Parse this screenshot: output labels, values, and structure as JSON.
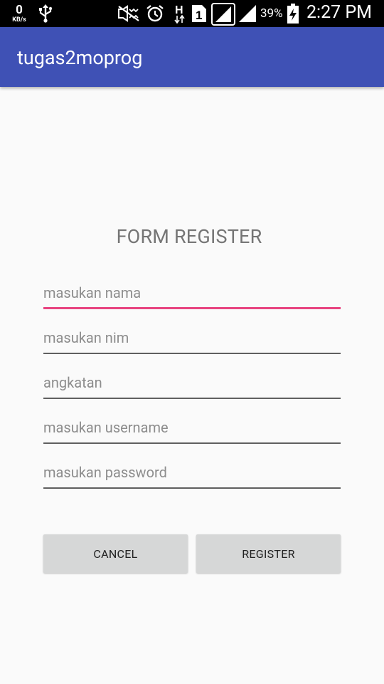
{
  "status_bar": {
    "net_speed_value": "0",
    "net_speed_unit": "KB/s",
    "hsig_label": "H",
    "sim_label": "1",
    "battery_percent": "39%",
    "time": "2:27 PM",
    "icons": [
      "usb-icon",
      "mute-icon",
      "alarm-icon",
      "network-type-icon",
      "sim-icon",
      "signal-icon",
      "signal-icon",
      "battery-charging-icon"
    ]
  },
  "app_bar": {
    "title": "tugas2moprog"
  },
  "form": {
    "title": "FORM REGISTER",
    "fields": [
      {
        "placeholder": "masukan nama",
        "value": ""
      },
      {
        "placeholder": "masukan nim",
        "value": ""
      },
      {
        "placeholder": "angkatan",
        "value": ""
      },
      {
        "placeholder": "masukan username",
        "value": ""
      },
      {
        "placeholder": "masukan password",
        "value": ""
      }
    ],
    "buttons": {
      "cancel": "CANCEL",
      "register": "REGISTER"
    }
  },
  "colors": {
    "app_bar": "#3f51b5",
    "focus_underline": "#e8437f",
    "button_bg": "#d6d7d7",
    "page_bg": "#fafafa"
  }
}
